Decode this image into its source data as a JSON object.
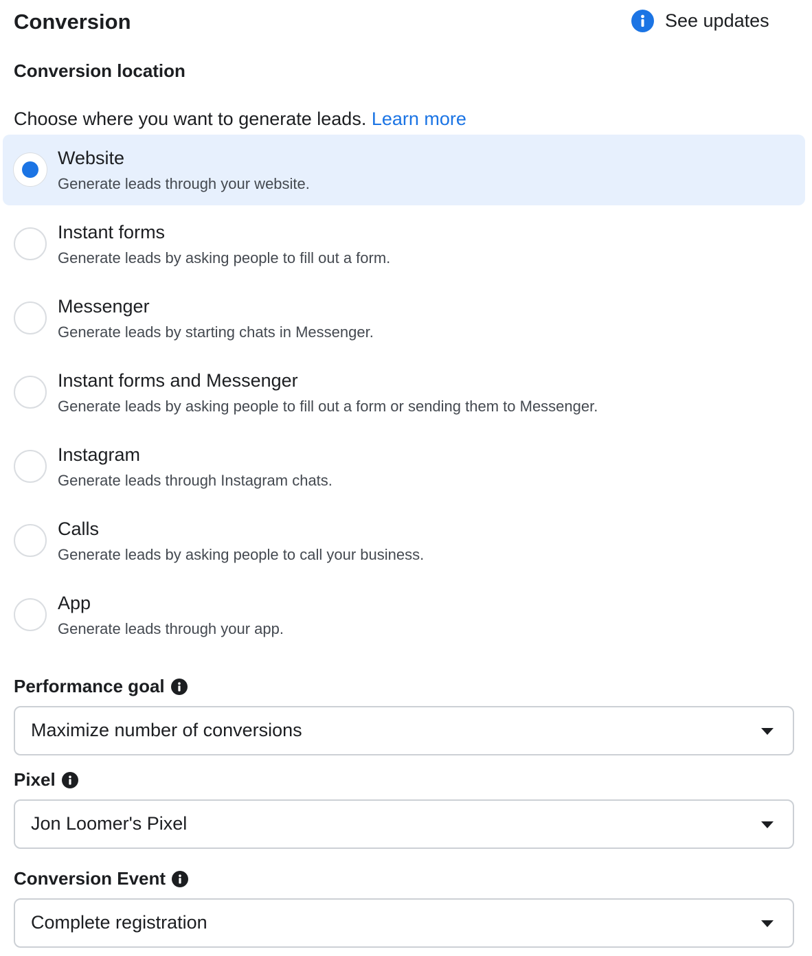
{
  "header": {
    "title": "Conversion",
    "see_updates_label": "See updates"
  },
  "conversion_location": {
    "title": "Conversion location",
    "intro_text": "Choose where you want to generate leads.",
    "learn_more": "Learn more",
    "selected": "Website",
    "options": [
      {
        "label": "Website",
        "description": "Generate leads through your website.",
        "selected": true
      },
      {
        "label": "Instant forms",
        "description": "Generate leads by asking people to fill out a form.",
        "selected": false
      },
      {
        "label": "Messenger",
        "description": "Generate leads by starting chats in Messenger.",
        "selected": false
      },
      {
        "label": "Instant forms and Messenger",
        "description": "Generate leads by asking people to fill out a form or sending them to Messenger.",
        "selected": false
      },
      {
        "label": "Instagram",
        "description": "Generate leads through Instagram chats.",
        "selected": false
      },
      {
        "label": "Calls",
        "description": "Generate leads by asking people to call your business.",
        "selected": false
      },
      {
        "label": "App",
        "description": "Generate leads through your app.",
        "selected": false
      }
    ]
  },
  "performance_goal": {
    "label": "Performance goal",
    "value": "Maximize number of conversions"
  },
  "pixel": {
    "label": "Pixel",
    "value": "Jon Loomer's Pixel"
  },
  "conversion_event": {
    "label": "Conversion Event",
    "value": "Complete registration"
  },
  "colors": {
    "accent": "#1b74e4",
    "selected_background": "#e7f0fd",
    "text": "#1c1e21",
    "secondary_text": "#444950",
    "border": "#ccd0d5"
  },
  "icons": {
    "see_updates": "info-icon",
    "field_info": "info-icon",
    "dropdown": "caret-down-icon"
  }
}
